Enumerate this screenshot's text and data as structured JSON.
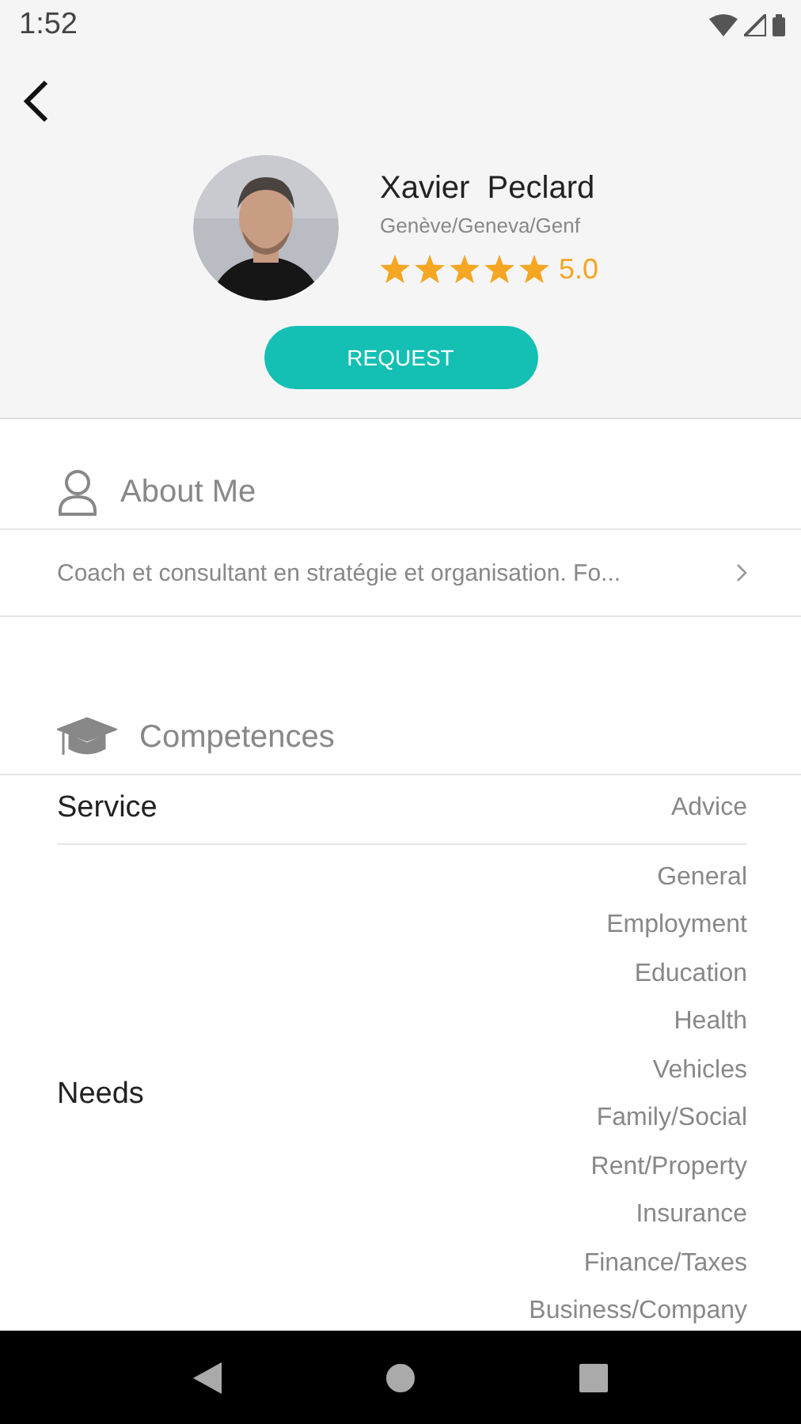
{
  "status_bar": {
    "time": "1:52"
  },
  "profile": {
    "name": "Xavier  Peclard",
    "location": "Genève/Geneva/Genf",
    "stars": 5,
    "rating": "5.0",
    "button": "REQUEST"
  },
  "about": {
    "title": "About Me",
    "description": "Coach et consultant en stratégie et organisation. Fo..."
  },
  "competences": {
    "title": "Competences",
    "rows": [
      {
        "label": "Service",
        "values": [
          "Advice"
        ]
      },
      {
        "label": "Needs",
        "values": [
          "General",
          "Employment",
          "Education",
          "Health",
          "Vehicles",
          "Family/Social",
          "Rent/Property",
          "Insurance",
          "Finance/Taxes",
          "Business/Company"
        ]
      }
    ]
  }
}
